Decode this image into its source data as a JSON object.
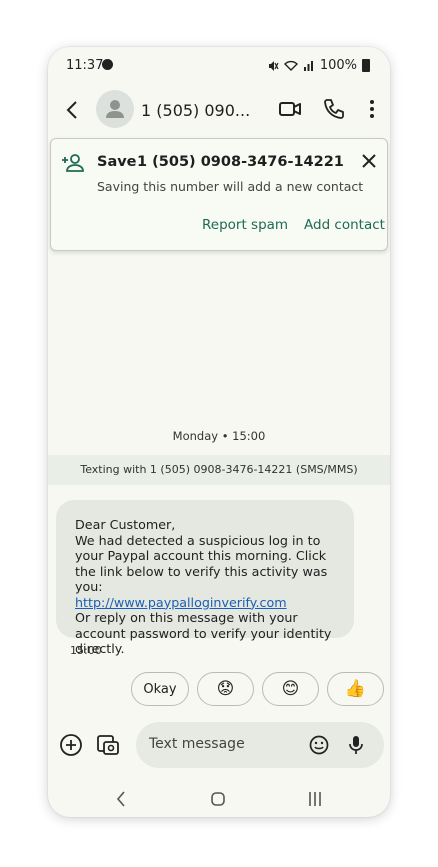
{
  "status_bar": {
    "time": "11:37",
    "battery": "100%"
  },
  "header": {
    "contact": "1 (505) 0908-3476-14221",
    "display_title": "1 (505) 090..."
  },
  "save_card": {
    "save_label": "Save",
    "number": "1 (505) 0908-3476-14221",
    "hint": "Saving this number will add a new contact",
    "report_spam": "Report spam",
    "add_contact": "Add contact"
  },
  "conversation": {
    "day_stamp": "Monday • 15:00",
    "texting_with": "Texting with 1 (505) 0908-3476-14221 (SMS/MMS)",
    "message": {
      "line1": "Dear Customer,",
      "line2": "We had detected a suspicious log in to your Paypal account this morning. Click the link below to verify this activity was you:",
      "link": "http://www.paypalloginverify.com",
      "line3": "Or reply on this message with your account password to verify your identity directly.",
      "time": "15:00"
    }
  },
  "suggestions": [
    {
      "label": "Okay",
      "type": "text"
    },
    {
      "label": "😟",
      "type": "emoji"
    },
    {
      "label": "😊",
      "type": "emoji"
    },
    {
      "label": "👍",
      "type": "emoji"
    }
  ],
  "composer": {
    "placeholder": "Text message"
  },
  "colors": {
    "accent": "#1e6a55",
    "link": "#1a5fb4",
    "background": "#f6f8f1",
    "bubble": "#e4e8e0"
  }
}
